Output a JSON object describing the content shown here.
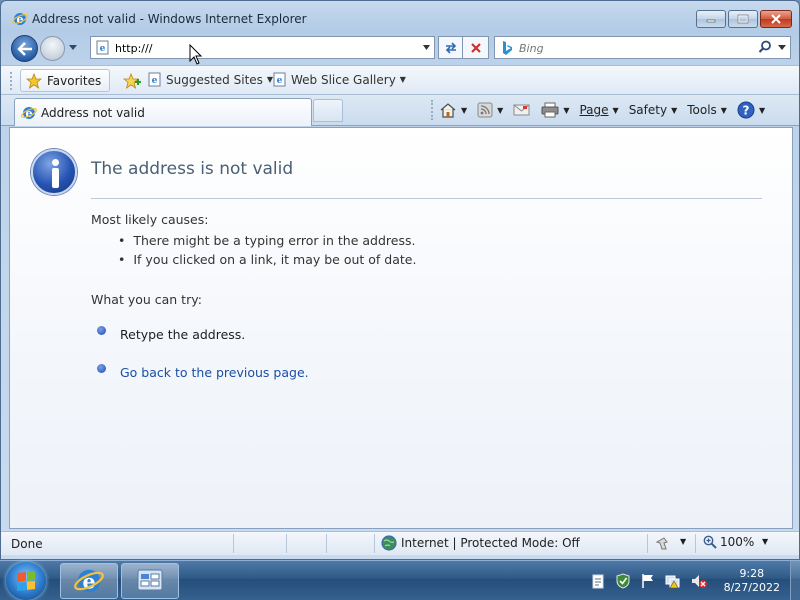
{
  "window": {
    "title": "Address not valid - Windows Internet Explorer",
    "controls": [
      "minimize",
      "maximize",
      "close"
    ]
  },
  "nav": {
    "address": "http:///",
    "search_placeholder": "Bing"
  },
  "favorites_bar": {
    "favorites_label": "Favorites",
    "items": [
      {
        "label": "Suggested Sites",
        "icon": "ie-page-icon"
      },
      {
        "label": "Web Slice Gallery",
        "icon": "ie-page-icon"
      }
    ]
  },
  "tab": {
    "title": "Address not valid"
  },
  "command_bar": {
    "page": "Page",
    "safety": "Safety",
    "tools": "Tools"
  },
  "content": {
    "heading": "The address is not valid",
    "causes_label": "Most likely causes:",
    "causes": [
      "There might be a typing error in the address.",
      "If you clicked on a link, it may be out of date."
    ],
    "try_label": "What you can try:",
    "try_items": [
      {
        "label": "Retype the address.",
        "is_link": false
      },
      {
        "label": "Go back to the previous page.",
        "is_link": true
      }
    ]
  },
  "status_bar": {
    "status": "Done",
    "zone": "Internet | Protected Mode: Off",
    "zoom": "100%"
  },
  "taskbar": {
    "time": "9:28",
    "date": "8/27/2022"
  }
}
